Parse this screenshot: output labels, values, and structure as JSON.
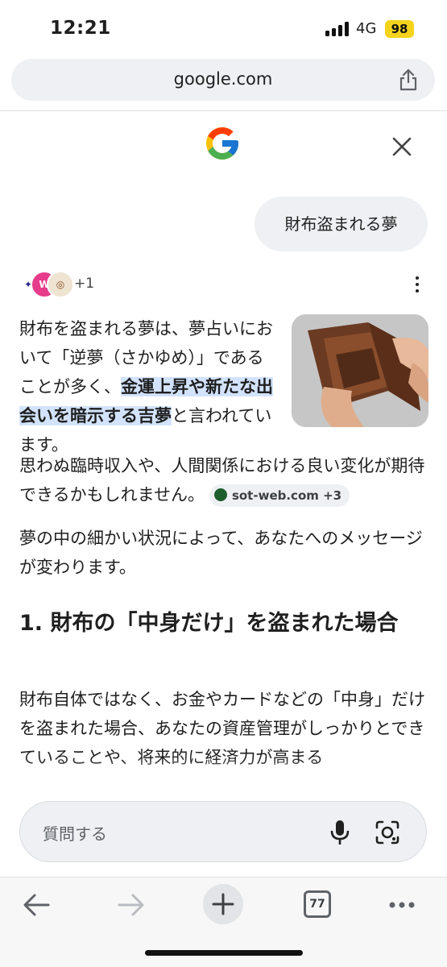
{
  "status": {
    "time": "12:21",
    "network": "4G",
    "battery": "98"
  },
  "browser": {
    "url": "google.com",
    "tab_count": "77"
  },
  "query": "財布盗まれる夢",
  "sources": {
    "more_count": "+1",
    "favicon_texts": [
      "W"
    ]
  },
  "answer": {
    "lead_1": "財布を盗まれる夢は、夢占いにおいて「逆夢（さかゆめ）」であることが多く、",
    "highlight": "金運上昇や新たな出会いを暗示する吉夢",
    "lead_2": "と言われています。",
    "continuation": "思わぬ臨時収入や、人間関係における良い変化が期待できるかもしれません。",
    "citation": "sot-web.com +3",
    "paragraph_2": "夢の中の細かい状況によって、あなたへのメッセージが変わります。",
    "heading_1": "1. 財布の「中身だけ」を盗まれた場合",
    "paragraph_3": "財布自体ではなく、お金やカードなどの「中身」だけを盗まれた場合、あなたの資産管理がしっかりとできていることや、将来的に経済力が高まる"
  },
  "input": {
    "placeholder": "質問する"
  },
  "icons": [
    "share-icon",
    "google-logo",
    "close-icon",
    "more-vert-icon",
    "mic-icon",
    "lens-icon",
    "back-icon",
    "forward-icon",
    "new-tab-icon",
    "tabs-icon",
    "menu-icon"
  ],
  "colors": {
    "highlight": "#d3e3fd",
    "battery": "#f4d31b",
    "chip_bg": "#eef0f3"
  }
}
